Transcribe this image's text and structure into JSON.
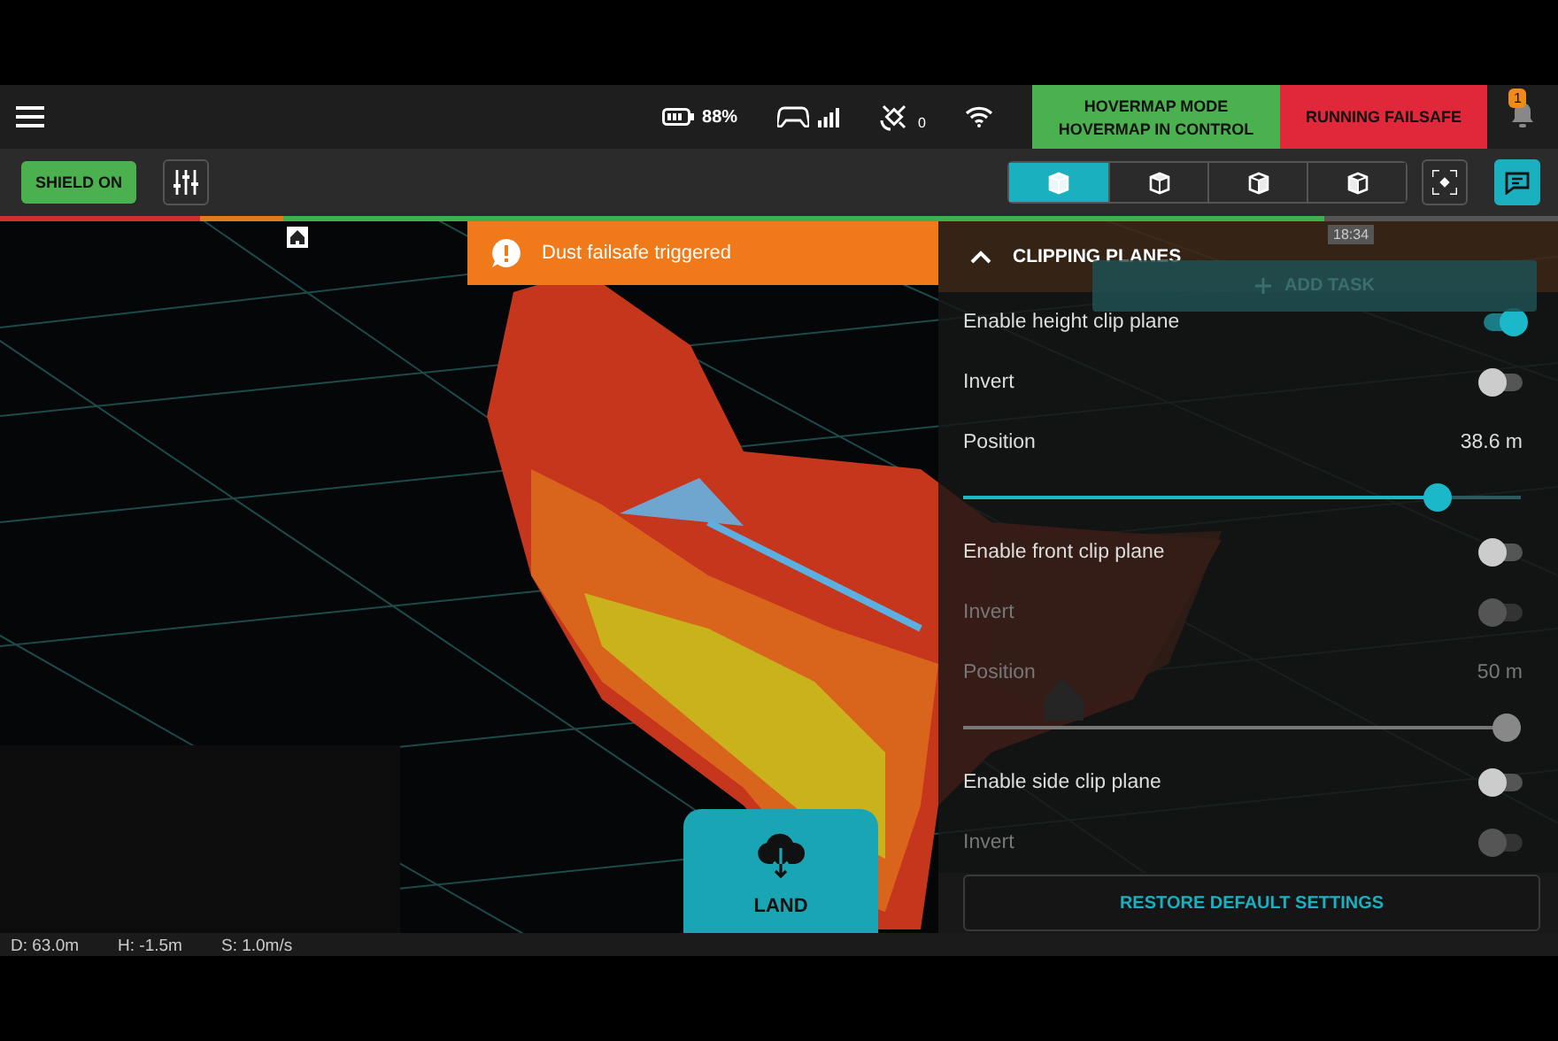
{
  "top_bar": {
    "battery": "88%",
    "satellites": "0",
    "mode": {
      "title": "HOVERMAP MODE",
      "subtitle": "HOVERMAP IN CONTROL"
    },
    "failsafe": "RUNNING FAILSAFE",
    "notifications": "1"
  },
  "mission_progress": {
    "level": 0.85
  },
  "toolbar": {
    "shield": "SHIELD ON",
    "views": [
      {
        "selected": true
      },
      {
        "selected": false
      },
      {
        "selected": false
      },
      {
        "selected": false
      }
    ],
    "chat": {
      "selected": true
    }
  },
  "map": {
    "toast": "Dust failsafe triggered",
    "clock": "18:34",
    "add_task": "ADD TASK",
    "land": "LAND"
  },
  "panel": {
    "title": "CLIPPING PLANES",
    "expanded": true,
    "rows": [
      {
        "kind": "toggle",
        "label": "Enable height clip plane",
        "on": true,
        "disabled": false
      },
      {
        "kind": "toggle",
        "label": "Invert",
        "on": false,
        "disabled": false
      },
      {
        "kind": "slider",
        "label": "Position",
        "reading": "38.6 m",
        "level": 0.87,
        "disabled": false
      },
      {
        "kind": "toggle",
        "label": "Enable front clip plane",
        "on": false,
        "disabled": false
      },
      {
        "kind": "toggle",
        "label": "Invert",
        "on": false,
        "disabled": true
      },
      {
        "kind": "slider",
        "label": "Position",
        "reading": "50 m",
        "level": 1,
        "disabled": true
      },
      {
        "kind": "toggle",
        "label": "Enable side clip plane",
        "on": false,
        "disabled": false
      },
      {
        "kind": "toggle",
        "label": "Invert",
        "on": false,
        "disabled": true
      }
    ],
    "restore": "RESTORE DEFAULT SETTINGS"
  },
  "status_bar": [
    "D: 63.0m",
    "H: -1.5m",
    "S: 1.0m/s"
  ]
}
